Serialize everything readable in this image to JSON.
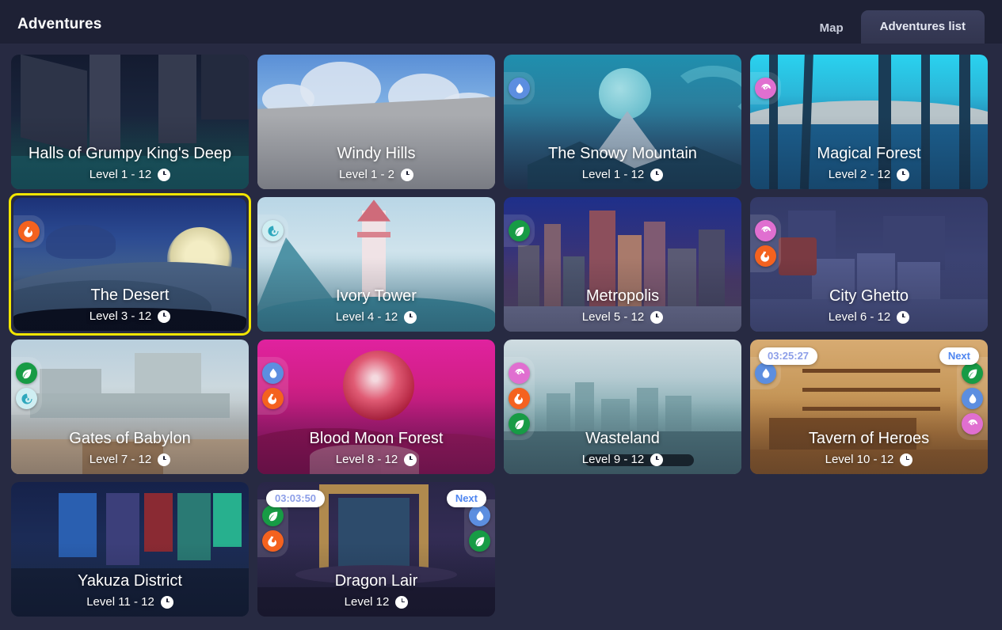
{
  "header": {
    "title": "Adventures",
    "tabs": [
      {
        "label": "Map",
        "active": false
      },
      {
        "label": "Adventures list",
        "active": true
      }
    ]
  },
  "cards": [
    {
      "title": "Halls of Grumpy King's Deep",
      "level": "Level 1 - 12",
      "scene": "s-halls",
      "selected": false,
      "badges_left": [],
      "badges_right": [],
      "timer": null,
      "next_label": null
    },
    {
      "title": "Windy Hills",
      "level": "Level 1 - 2",
      "scene": "s-windy",
      "selected": false,
      "badges_left": [],
      "badges_right": [],
      "timer": null,
      "next_label": null
    },
    {
      "title": "The Snowy Mountain",
      "level": "Level 1 - 12",
      "scene": "s-snowy",
      "selected": false,
      "badges_left": [
        "water"
      ],
      "badges_right": [],
      "timer": null,
      "next_label": null
    },
    {
      "title": "Magical Forest",
      "level": "Level 2 - 12",
      "scene": "s-mforest",
      "selected": false,
      "badges_left": [
        "magic"
      ],
      "badges_right": [],
      "timer": null,
      "next_label": null
    },
    {
      "title": "The Desert",
      "level": "Level 3 - 12",
      "scene": "s-desert",
      "selected": true,
      "badges_left": [
        "fire"
      ],
      "badges_right": [],
      "timer": null,
      "next_label": null
    },
    {
      "title": "Ivory Tower",
      "level": "Level 4 - 12",
      "scene": "s-ivory",
      "selected": false,
      "badges_left": [
        "air"
      ],
      "badges_right": [],
      "timer": null,
      "next_label": null
    },
    {
      "title": "Metropolis",
      "level": "Level 5 - 12",
      "scene": "s-metro",
      "selected": false,
      "badges_left": [
        "nature"
      ],
      "badges_right": [],
      "timer": null,
      "next_label": null
    },
    {
      "title": "City Ghetto",
      "level": "Level 6 - 12",
      "scene": "s-ghetto",
      "selected": false,
      "badges_left": [
        "magic",
        "fire"
      ],
      "badges_right": [],
      "timer": null,
      "next_label": null
    },
    {
      "title": "Gates of Babylon",
      "level": "Level 7 - 12",
      "scene": "s-babylon",
      "selected": false,
      "badges_left": [
        "nature",
        "air"
      ],
      "badges_right": [],
      "timer": null,
      "next_label": null
    },
    {
      "title": "Blood Moon Forest",
      "level": "Level 8 - 12",
      "scene": "s-blood",
      "selected": false,
      "badges_left": [
        "water",
        "fire"
      ],
      "badges_right": [],
      "timer": null,
      "next_label": null
    },
    {
      "title": "Wasteland",
      "level": "Level 9 - 12",
      "scene": "s-waste",
      "selected": false,
      "badges_left": [
        "magic",
        "fire",
        "nature"
      ],
      "badges_right": [],
      "timer": null,
      "next_label": null
    },
    {
      "title": "Tavern of Heroes",
      "level": "Level 10 - 12",
      "scene": "s-tavern",
      "selected": false,
      "badges_left": [
        "water"
      ],
      "badges_right": [
        "nature",
        "water",
        "magic"
      ],
      "timer": "03:25:27",
      "next_label": "Next"
    },
    {
      "title": "Yakuza District",
      "level": "Level 11 - 12",
      "scene": "s-yakuza",
      "selected": false,
      "badges_left": [],
      "badges_right": [],
      "timer": null,
      "next_label": null
    },
    {
      "title": "Dragon Lair",
      "level": "Level 12",
      "scene": "s-dragon",
      "selected": false,
      "badges_left": [
        "nature",
        "fire"
      ],
      "badges_right": [
        "water",
        "nature"
      ],
      "timer": "03:03:50",
      "next_label": "Next"
    }
  ],
  "icons": {
    "clock": "clock-icon",
    "fire": "fire-icon",
    "water": "water-drop-icon",
    "nature": "leaf-icon",
    "magic": "magic-spiral-icon",
    "air": "air-spiral-icon"
  },
  "colors": {
    "page_background": "#272a42",
    "header_background": "#1e2135",
    "tab_active_background": "#3b3f5d",
    "selected_outline": "#f2e500",
    "badge_fire": "#f4621f",
    "badge_water": "#5c8ee0",
    "badge_nature": "#179b45",
    "badge_magic": "#e06fd0",
    "badge_air": "#cfeef2",
    "timer_text": "#8c9ee8",
    "next_text": "#4f86f0"
  }
}
